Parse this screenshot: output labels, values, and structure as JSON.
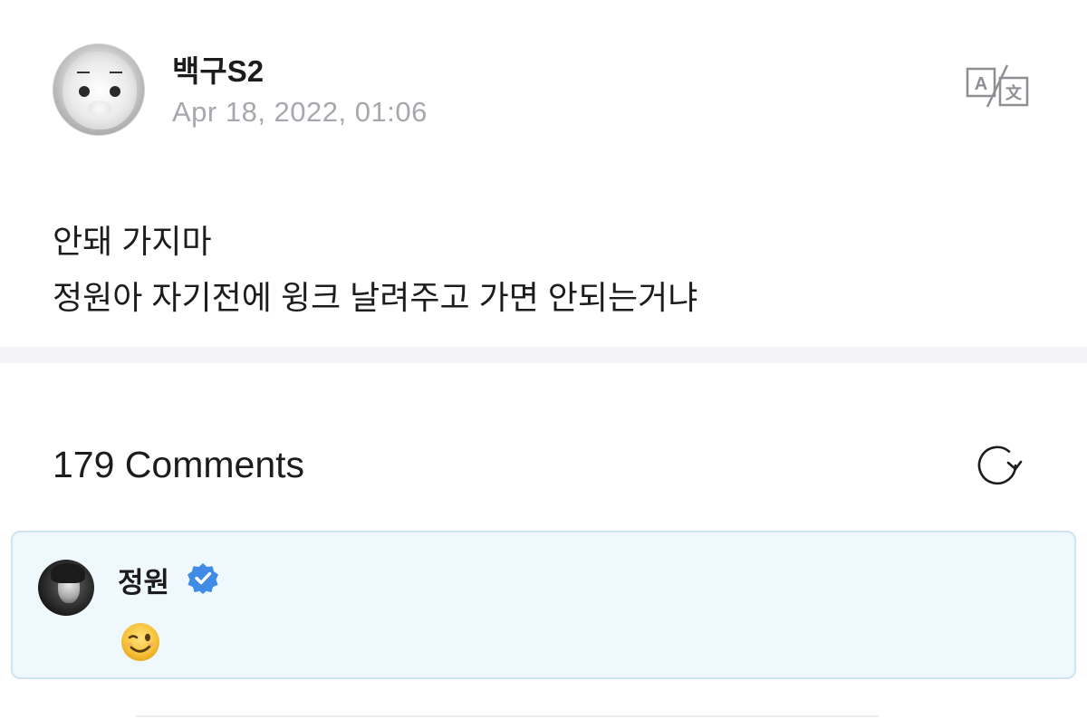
{
  "post": {
    "author": "백구S2",
    "date": "Apr 18, 2022, 01:06",
    "body_lines": [
      "안돼 가지마",
      "정원아 자기전에 윙크 날려주고 가면 안되는거냐"
    ],
    "icons": {
      "avatar": "user-avatar-icon",
      "translate": "translate-icon"
    }
  },
  "comments": {
    "count_label": "179 Comments",
    "refresh_icon": "refresh-icon",
    "items": [
      {
        "author": "정원",
        "verified": true,
        "content_emoji": "winking-face-emoji",
        "highlighted": true
      }
    ]
  },
  "colors": {
    "text_primary": "#1c1c1e",
    "text_secondary": "#a7a7ad",
    "divider": "#f3f3f6",
    "highlight_bg": "#eef8fd",
    "highlight_border": "#cfe6f2",
    "verified_blue": "#3f8be6",
    "emoji_yellow": "#f6c23b"
  }
}
